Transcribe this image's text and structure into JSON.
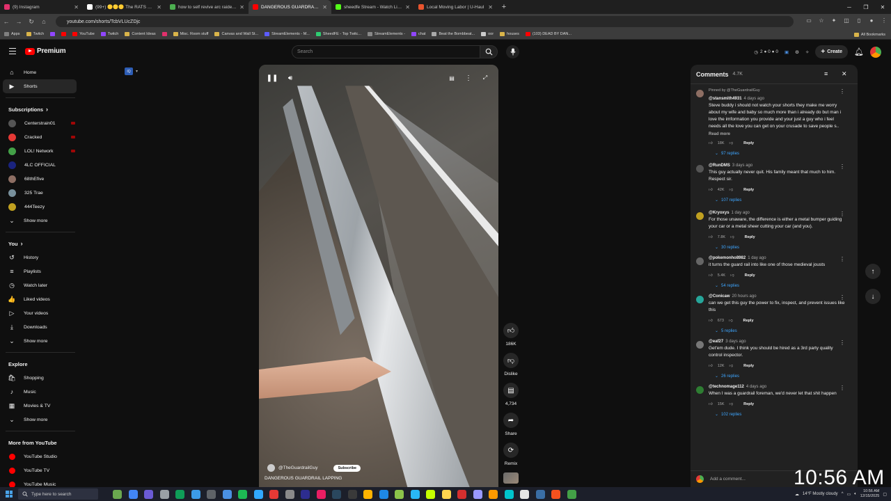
{
  "browser": {
    "tabs": [
      {
        "title": "(9) Instagram",
        "color": "#e1306c",
        "active": false
      },
      {
        "title": "(99+) 🟡🟡🟡 The RATS are o...",
        "color": "#ffffff",
        "active": false
      },
      {
        "title": "how to self revive arc raiders -",
        "color": "#4caf50",
        "active": false
      },
      {
        "title": "DANGEROUS GUARDRAIL L",
        "color": "#ff0000",
        "active": true
      },
      {
        "title": "sheedfe Stream - Watch Live c",
        "color": "#53fc18",
        "active": false
      },
      {
        "title": "Local Moving Labor | U-Haul",
        "color": "#e8542e",
        "active": false
      }
    ],
    "url": "youtube.com/shorts/TcbVLUcZDjc",
    "bookmarks": [
      {
        "label": "Apps",
        "color": "#7f7f7f"
      },
      {
        "label": "Twitch",
        "color": "#d9b44a"
      },
      {
        "label": "",
        "color": "#9146ff"
      },
      {
        "label": "",
        "color": "#ff0000"
      },
      {
        "label": "YouTube",
        "color": "#ff0000"
      },
      {
        "label": "Twitch",
        "color": "#9146ff"
      },
      {
        "label": "Content Ideas",
        "color": "#d9b44a"
      },
      {
        "label": "",
        "color": "#e1306c"
      },
      {
        "label": "Misc. Room stuff",
        "color": "#d9b44a"
      },
      {
        "label": "Canvas and Wall St...",
        "color": "#d9b44a"
      },
      {
        "label": "StreamElements - M...",
        "color": "#5c5cff"
      },
      {
        "label": "SheedFE - Top Twitc...",
        "color": "#2ecc71"
      },
      {
        "label": "StreamElements -",
        "color": "#888888"
      },
      {
        "label": "chat",
        "color": "#9146ff"
      },
      {
        "label": "Beat the Bombbeat...",
        "color": "#aaaaaa"
      },
      {
        "label": "oor",
        "color": "#cccccc"
      },
      {
        "label": "houses",
        "color": "#d9b44a"
      },
      {
        "label": "(103) DEAD BY DAN...",
        "color": "#ff0000"
      }
    ],
    "all_bookmarks": "All Bookmarks"
  },
  "header": {
    "brand": "Premium",
    "search_placeholder": "Search",
    "stats": "2 ● 0 ● 0",
    "create_label": "Create"
  },
  "sidebar": {
    "main": [
      {
        "label": "Home",
        "icon": "⌂"
      },
      {
        "label": "Shorts",
        "icon": "▶"
      }
    ],
    "subscriptions_title": "Subscriptions",
    "subscriptions": [
      {
        "label": "Centerstrain01",
        "color": "#555555",
        "live": true
      },
      {
        "label": "Cracked",
        "color": "#e53935",
        "live": true
      },
      {
        "label": "LOL! Network",
        "color": "#43a047",
        "live": true
      },
      {
        "label": "4LC OFFICIAL",
        "color": "#1a237e",
        "live": false
      },
      {
        "label": "68thEfive",
        "color": "#8d6e63",
        "live": false
      },
      {
        "label": "325 Trae",
        "color": "#78909c",
        "live": false
      },
      {
        "label": "444Teezy",
        "color": "#c0a020",
        "live": false
      }
    ],
    "show_more": "Show more",
    "you_title": "You",
    "you": [
      {
        "label": "History",
        "icon": "↺"
      },
      {
        "label": "Playlists",
        "icon": "≡"
      },
      {
        "label": "Watch later",
        "icon": "◷"
      },
      {
        "label": "Liked videos",
        "icon": "👍"
      },
      {
        "label": "Your videos",
        "icon": "▷"
      },
      {
        "label": "Downloads",
        "icon": "⤓"
      }
    ],
    "explore_title": "Explore",
    "explore": [
      {
        "label": "Shopping",
        "icon": "🛍"
      },
      {
        "label": "Music",
        "icon": "♪"
      },
      {
        "label": "Movies & TV",
        "icon": "▦"
      }
    ],
    "more_title": "More from YouTube",
    "more": [
      {
        "label": "YouTube Studio"
      },
      {
        "label": "YouTube TV"
      },
      {
        "label": "YouTube Music"
      }
    ]
  },
  "video": {
    "channel": "@TheGuardrailGuy",
    "subscribe": "Subscribe",
    "title": "DANGEROUS GUARDRAIL LAPPING"
  },
  "actions": {
    "likes": "186K",
    "dislike": "Dislike",
    "comments": "4,734",
    "share": "Share",
    "remix": "Remix"
  },
  "comments": {
    "title": "Comments",
    "count": "4.7K",
    "add_placeholder": "Add a comment...",
    "items": [
      {
        "pinned": "Pinned by @TheGuardrailGuy",
        "author": "@stansmith4931",
        "time": "4 days ago",
        "text": "Steve buddy i should not watch your shorts they make me worry about my wife and baby so much more than i already do but man i love the imformation you provide and your just a guy who i feel needs all the love you can get on your crusade to save people s..",
        "more": "Read more",
        "likes": "18K",
        "replies": "97 replies",
        "avcolor": "#8d6e63"
      },
      {
        "pinned": "",
        "author": "@RunDMS",
        "time": "3 days ago",
        "text": "This guy actually never quit. His family meant that much to him. Respect sir.",
        "more": "",
        "likes": "42K",
        "replies": "107 replies",
        "avcolor": "#555555"
      },
      {
        "pinned": "",
        "author": "@Kryoxys",
        "time": "1 day ago",
        "text": "For those unaware, the difference is either a metal bumper guiding your car or a metal sheer cutting your car (and you).",
        "more": "",
        "likes": "7.8K",
        "replies": "30 replies",
        "avcolor": "#c0a020"
      },
      {
        "pinned": "",
        "author": "@pokemonho8982",
        "time": "1 day ago",
        "text": "it turns the guard rail into like one of those medieval jousts",
        "more": "",
        "likes": "5.4K",
        "replies": "54 replies",
        "avcolor": "#666666"
      },
      {
        "pinned": "",
        "author": "@Conicaw",
        "time": "20 hours ago",
        "text": "can we get this guy the power to fix, inspect, and prevent issues like this",
        "more": "",
        "likes": "673",
        "replies": "5 replies",
        "avcolor": "#26a69a"
      },
      {
        "pinned": "",
        "author": "@eaf27",
        "time": "3 days ago",
        "text": "Get'em dude.  I think you should be hired as a 3rd party quality control inspector.",
        "more": "",
        "likes": "12K",
        "replies": "26 replies",
        "avcolor": "#777777"
      },
      {
        "pinned": "",
        "author": "@technomage112",
        "time": "4 days ago",
        "text": "When I was a guardrail foreman, we'd never let that shit happen",
        "more": "",
        "likes": "15K",
        "replies": "102 replies",
        "avcolor": "#2e7d32"
      }
    ],
    "reply_label": "Reply"
  },
  "overlay_clock": "10:56 AM",
  "taskbar": {
    "search_placeholder": "Type here to search",
    "weather": "14°F  Mostly cloudy",
    "time": "10:56 AM",
    "date": "12/15/2025",
    "apps": [
      "#6aa84f",
      "#4285f4",
      "#6b5bd6",
      "#9aa0a6",
      "#0f9d58",
      "#3c9be8",
      "#5f6368",
      "#4a90e2",
      "#1db954",
      "#31a8ff",
      "#e53935",
      "#8a8a8a",
      "#2d2d8f",
      "#e91e63",
      "#2a475e",
      "#3a3a3a",
      "#ffb300",
      "#1e88e5",
      "#8bc34a",
      "#29b6f6",
      "#c6ff00",
      "#ffd54f",
      "#d32f2f",
      "#9999ff",
      "#ff9a00",
      "#00c4cc",
      "#e6e6e6",
      "#3a6ea5",
      "#f4511e",
      "#43a047"
    ]
  }
}
